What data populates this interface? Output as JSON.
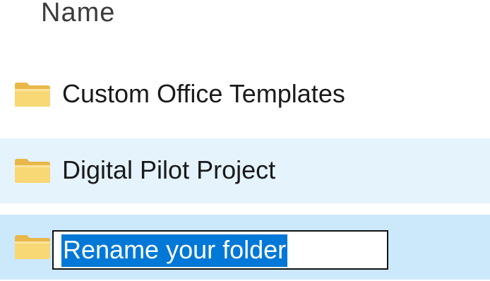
{
  "header": {
    "column_label": "Name"
  },
  "rows": [
    {
      "label": "Custom Office Templates",
      "icon": "folder-icon",
      "state": "normal"
    },
    {
      "label": "Digital Pilot Project",
      "icon": "folder-icon",
      "state": "hover"
    },
    {
      "label": "Rename your folder",
      "icon": "folder-icon",
      "state": "renaming"
    }
  ],
  "colors": {
    "hover_bg": "#e5f3fd",
    "selected_bg": "#cce8fb",
    "text_selection": "#0078d7",
    "folder_yellow": "#f8d775"
  }
}
